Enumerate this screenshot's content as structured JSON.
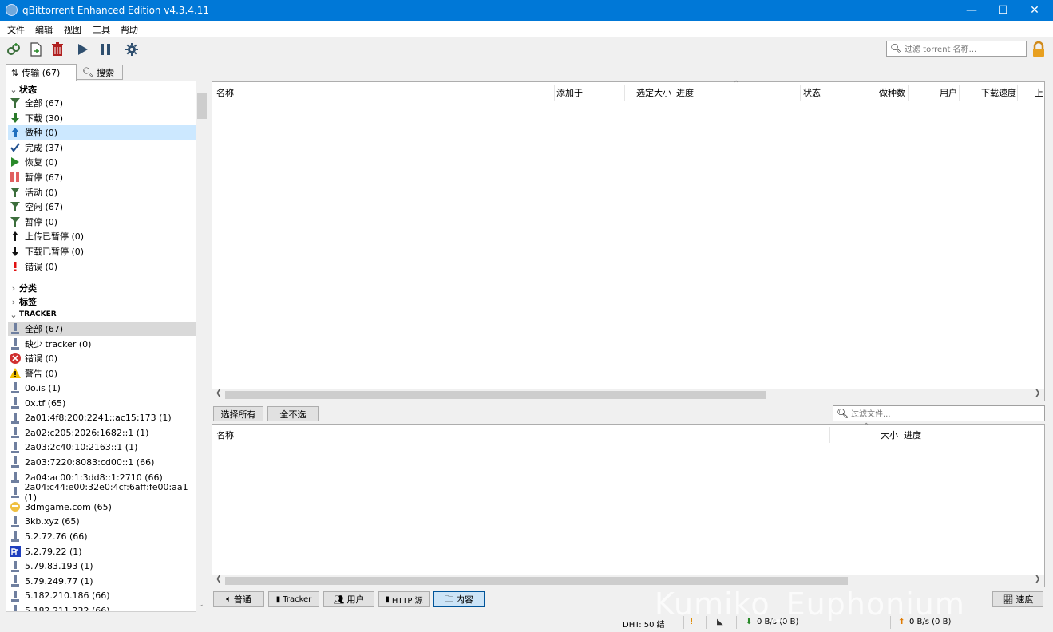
{
  "window": {
    "title": "qBittorrent Enhanced Edition v4.3.4.11",
    "minimize": "—",
    "maximize": "☐",
    "close": "✕"
  },
  "menu": [
    "文件",
    "编辑",
    "视图",
    "工具",
    "帮助"
  ],
  "top_filter": {
    "placeholder": "过滤 torrent 名称..."
  },
  "left_tabs": {
    "transfer": "传输 (67)",
    "search": "搜索"
  },
  "sidebar": {
    "status_header": "状态",
    "status_items": [
      {
        "label": "全部 (67)",
        "icon": "filter-icon"
      },
      {
        "label": "下载 (30)",
        "icon": "download-arrow-icon"
      },
      {
        "label": "做种 (0)",
        "icon": "upload-arrow-icon"
      },
      {
        "label": "完成 (37)",
        "icon": "checkmark-icon"
      },
      {
        "label": "恢复 (0)",
        "icon": "play-icon"
      },
      {
        "label": "暂停 (67)",
        "icon": "pause-icon"
      },
      {
        "label": "活动 (0)",
        "icon": "filter-icon"
      },
      {
        "label": "空闲 (67)",
        "icon": "filter-icon"
      },
      {
        "label": "暂停 (0)",
        "icon": "filter-icon"
      },
      {
        "label": "上传已暂停 (0)",
        "icon": "up-arrow-icon"
      },
      {
        "label": "下载已暂停 (0)",
        "icon": "down-arrow-icon"
      },
      {
        "label": "错误 (0)",
        "icon": "exclamation-icon"
      }
    ],
    "category_header": "分类",
    "tags_header": "标签",
    "tracker_header": "TRACKER",
    "tracker_items": [
      {
        "label": "全部 (67)",
        "icon": "tracker-icon"
      },
      {
        "label": "缺少 tracker (0)",
        "icon": "tracker-icon"
      },
      {
        "label": "错误 (0)",
        "icon": "error-circle-icon"
      },
      {
        "label": "警告 (0)",
        "icon": "warning-icon"
      },
      {
        "label": "0o.is (1)",
        "icon": "tracker-icon"
      },
      {
        "label": "0x.tf (65)",
        "icon": "tracker-icon"
      },
      {
        "label": "2a01:4f8:200:2241::ac15:173 (1)",
        "icon": "tracker-icon"
      },
      {
        "label": "2a02:c205:2026:1682::1 (1)",
        "icon": "tracker-icon"
      },
      {
        "label": "2a03:2c40:10:2163::1 (1)",
        "icon": "tracker-icon"
      },
      {
        "label": "2a03:7220:8083:cd00::1 (66)",
        "icon": "tracker-icon"
      },
      {
        "label": "2a04:ac00:1:3dd8::1:2710 (66)",
        "icon": "tracker-icon"
      },
      {
        "label": "2a04:c44:e00:32e0:4cf:6aff:fe00:aa1 (1)",
        "icon": "tracker-icon"
      },
      {
        "label": "3dmgame.com (65)",
        "icon": "favicon-3dm-icon"
      },
      {
        "label": "3kb.xyz (65)",
        "icon": "tracker-icon"
      },
      {
        "label": "5.2.72.76 (66)",
        "icon": "tracker-icon"
      },
      {
        "label": "5.2.79.22 (1)",
        "icon": "favicon-pf-icon"
      },
      {
        "label": "5.79.83.193 (1)",
        "icon": "tracker-icon"
      },
      {
        "label": "5.79.249.77 (1)",
        "icon": "tracker-icon"
      },
      {
        "label": "5.182.210.186 (66)",
        "icon": "tracker-icon"
      },
      {
        "label": "5.182.211.232 (66)",
        "icon": "tracker-icon"
      }
    ]
  },
  "torrent_columns": [
    "名称",
    "添加于",
    "选定大小",
    "进度",
    "状态",
    "做种数",
    "用户",
    "下载速度",
    "上"
  ],
  "content_buttons": {
    "select_all": "选择所有",
    "select_none": "全不选"
  },
  "file_filter": {
    "placeholder": "过滤文件..."
  },
  "content_columns": [
    "名称",
    "大小",
    "进度"
  ],
  "bottom_tabs": [
    "普通",
    "Tracker",
    "用户",
    "HTTP 源",
    "内容"
  ],
  "speed_button": "速度",
  "statusbar": {
    "dht": "DHT: 50 结",
    "down": "0 B/s (0 B)",
    "up": "0 B/s (0 B)"
  },
  "watermark": "Kumiko_Euphonium"
}
